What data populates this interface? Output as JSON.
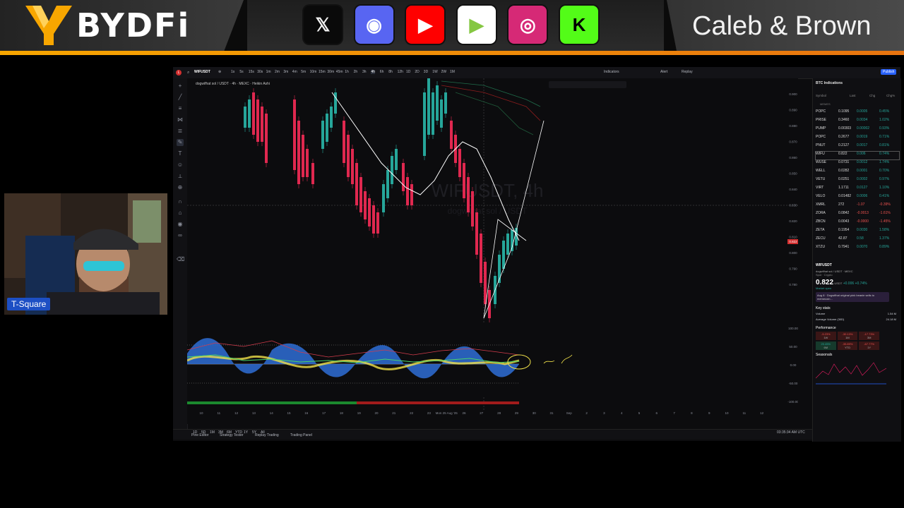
{
  "banner": {
    "logo_text": "BYDFi",
    "brand_name": "Caleb & Brown",
    "socials": [
      {
        "name": "x-icon",
        "color": "#f2f2f2",
        "bg": "#0a0a0a"
      },
      {
        "name": "discord-icon",
        "color": "#ffffff",
        "bg": "#5865f2"
      },
      {
        "name": "youtube-icon",
        "color": "#ffffff",
        "bg": "#ff0000"
      },
      {
        "name": "rumble-icon",
        "color": "#85c742",
        "bg": "#ffffff"
      },
      {
        "name": "instagram-icon",
        "color": "#ffffff",
        "bg": "#d62976"
      },
      {
        "name": "kick-icon",
        "color": "#000000",
        "bg": "#53fc18"
      }
    ]
  },
  "webcam": {
    "label": "T-Square"
  },
  "tv": {
    "symbol": "WIFUSDT",
    "intervals": [
      "1s",
      "5s",
      "15s",
      "30s",
      "1m",
      "2m",
      "3m",
      "4m",
      "5m",
      "10m",
      "15m",
      "30m",
      "45m",
      "1h",
      "2h",
      "3h",
      "4h",
      "6h",
      "8h",
      "12h",
      "1D",
      "2D",
      "3D",
      "1W",
      "2W",
      "1M"
    ],
    "indicators_label": "Indicators",
    "alert_label": "Alert",
    "replay_label": "Replay",
    "publish_label": "Publish",
    "legend": "dogwifhat sol / USDT · 4h · MEXC · Heikin Ashi",
    "watermark_symbol": "WIFUSDT, 4h",
    "watermark_sub": "dogwifhat sol / USDT",
    "price_scale": [
      "0.900",
      "0.890",
      "0.880",
      "0.870",
      "0.860",
      "0.850",
      "0.840",
      "0.830",
      "0.820",
      "0.810",
      "0.800",
      "0.790",
      "0.780"
    ],
    "current_price_tag": "0.822",
    "osc_scale": [
      "100.00",
      "50.00",
      "0.00",
      "-50.00",
      "-100.00"
    ],
    "time_axis": [
      "10",
      "11",
      "12",
      "13",
      "14",
      "15",
      "16",
      "17",
      "18",
      "19",
      "20",
      "21",
      "22",
      "23",
      "Mon 25 Aug '25",
      "26",
      "27",
      "28",
      "29",
      "30",
      "31",
      "Sep",
      "2",
      "3",
      "4",
      "5",
      "6",
      "7",
      "8",
      "9",
      "10",
      "11",
      "12"
    ],
    "ranges": [
      "1D",
      "5D",
      "1M",
      "3M",
      "6M",
      "YTD",
      "1Y",
      "5Y",
      "All"
    ],
    "clock": "03:35:34 AM UTC",
    "bottom_tabs": [
      "Pine Editor",
      "Strategy Tester",
      "Replay Trading",
      "Trading Panel"
    ]
  },
  "watchlist": {
    "title": "BTC Indications",
    "headers": [
      "Symbol",
      "Last",
      "Chg",
      "Chg%"
    ],
    "section": "MEMES",
    "rows": [
      {
        "sym": "POPC",
        "last": "0.1095",
        "chg": "0.0005",
        "pct": "0.45%",
        "up": true
      },
      {
        "sym": "PRISE",
        "last": "0.3460",
        "chg": "0.0034",
        "pct": "1.02%",
        "up": true
      },
      {
        "sym": "PUMP",
        "last": "0.00303",
        "chg": "0.00002",
        "pct": "0.93%",
        "up": true
      },
      {
        "sym": "POPC",
        "last": "0.2677",
        "chg": "0.0019",
        "pct": "0.71%",
        "up": true
      },
      {
        "sym": "PNUT",
        "last": "0.2127",
        "chg": "0.0017",
        "pct": "0.81%",
        "up": true
      },
      {
        "sym": "WIFU",
        "last": "0.822",
        "chg": "0.006",
        "pct": "0.74%",
        "up": true
      },
      {
        "sym": "WUSE",
        "last": "0.0731",
        "chg": "0.0012",
        "pct": "1.74%",
        "up": true
      },
      {
        "sym": "WELL",
        "last": "0.0282",
        "chg": "0.0001",
        "pct": "0.70%",
        "up": true
      },
      {
        "sym": "VETU",
        "last": "0.0251",
        "chg": "0.0002",
        "pct": "0.97%",
        "up": true
      },
      {
        "sym": "VIRT",
        "last": "1.1711",
        "chg": "0.0127",
        "pct": "1.10%",
        "up": true
      },
      {
        "sym": "VELO",
        "last": "0.01482",
        "chg": "0.0006",
        "pct": "0.41%",
        "up": true
      },
      {
        "sym": "XMRL",
        "last": "272",
        "chg": "-1.07",
        "pct": "-0.39%",
        "up": false
      },
      {
        "sym": "ZORA",
        "last": "0.0842",
        "chg": "-0.0013",
        "pct": "-1.61%",
        "up": false
      },
      {
        "sym": "ZBCN",
        "last": "0.0043",
        "chg": "-0.0000",
        "pct": "-1.45%",
        "up": false
      },
      {
        "sym": "ZETA",
        "last": "0.1954",
        "chg": "0.0030",
        "pct": "1.58%",
        "up": true
      },
      {
        "sym": "ZECU",
        "last": "42.87",
        "chg": "0.58",
        "pct": "1.37%",
        "up": true
      },
      {
        "sym": "XTZU",
        "last": "0.7941",
        "chg": "0.0070",
        "pct": "0.89%",
        "up": true
      }
    ]
  },
  "detail": {
    "symbol": "WIFUSDT",
    "desc": "dogwifhat sol / USDT · MEXC",
    "type": "Spot · Crypto",
    "price": "0.822",
    "currency": "USDT",
    "change": "+0.006",
    "change_pct": "+0.74%",
    "status": "Market open",
    "news": "Aug 8 · Dogwifhat original pink beanie sells to memecoin...",
    "key_stats": "Key stats",
    "volume_label": "Volume",
    "volume": "1.54 M",
    "avg_vol_label": "Average Volume (30D)",
    "avg_vol": "24.18 M",
    "performance_label": "Performance",
    "perf": [
      {
        "v": "-5.23%",
        "p": "1W",
        "up": false
      },
      {
        "v": "-30.13%",
        "p": "1M",
        "up": false
      },
      {
        "v": "-17.73%",
        "p": "3M",
        "up": false
      },
      {
        "v": "20.45%",
        "p": "6M",
        "up": true
      },
      {
        "v": "-35.89%",
        "p": "YTD",
        "up": false
      },
      {
        "v": "-67.77%",
        "p": "1Y",
        "up": false
      }
    ],
    "seasonals_label": "Seasonals"
  }
}
